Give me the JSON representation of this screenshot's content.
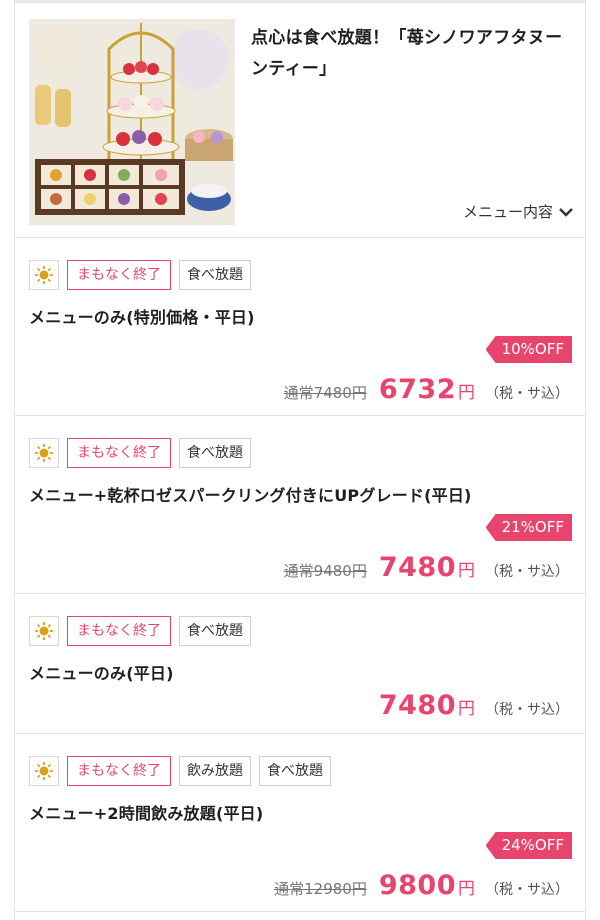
{
  "course": {
    "title": "点心は食べ放題！「苺シノワアフタヌーンティー」",
    "menu_toggle_label": "メニュー内容"
  },
  "plans": [
    {
      "tags": [
        "まもなく終了",
        "食べ放題"
      ],
      "name": "メニューのみ(特別価格・平日)",
      "discount": "10%OFF",
      "regular_price": "通常7480円",
      "price": "6732",
      "currency": "円",
      "tax": "（税・サ込）"
    },
    {
      "tags": [
        "まもなく終了",
        "食べ放題"
      ],
      "name": "メニュー+乾杯ロゼスパークリング付きにUPグレード(平日)",
      "discount": "21%OFF",
      "regular_price": "通常9480円",
      "price": "7480",
      "currency": "円",
      "tax": "（税・サ込）"
    },
    {
      "tags": [
        "まもなく終了",
        "食べ放題"
      ],
      "name": "メニューのみ(平日)",
      "price": "7480",
      "currency": "円",
      "tax": "（税・サ込）"
    },
    {
      "tags": [
        "まもなく終了",
        "飲み放題",
        "食べ放題"
      ],
      "name": "メニュー+2時間飲み放題(平日)",
      "discount": "24%OFF",
      "regular_price": "通常12980円",
      "price": "9800",
      "currency": "円",
      "tax": "（税・サ込）"
    }
  ],
  "colors": {
    "accent": "#e8456e",
    "sun_icon": "#d9a21b"
  },
  "icons": [
    "sun-icon",
    "chevron-down-icon"
  ]
}
